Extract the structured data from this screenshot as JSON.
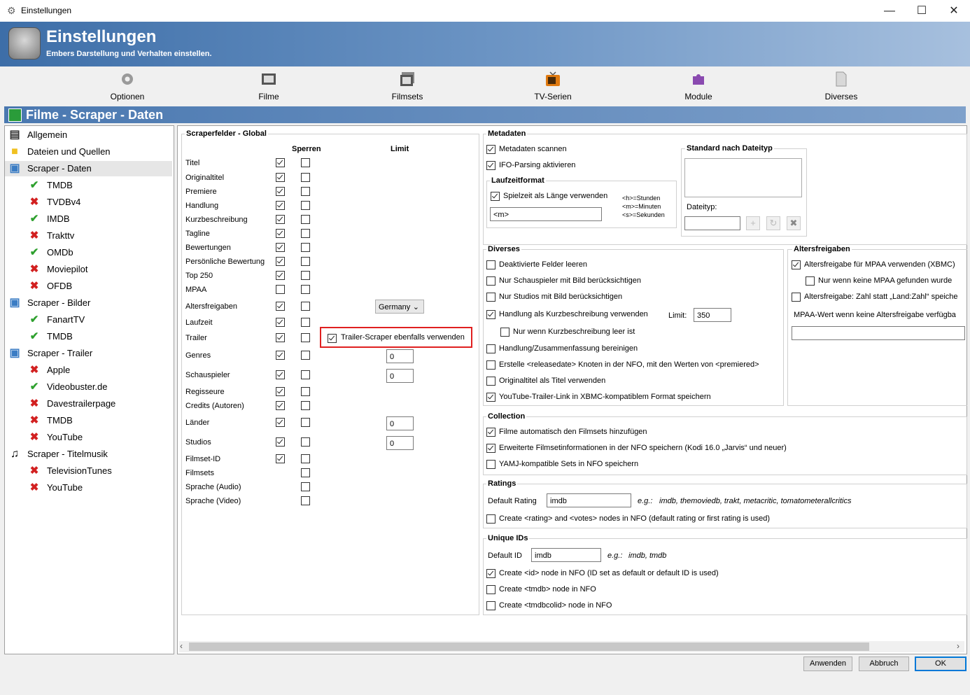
{
  "window": {
    "title": "Einstellungen",
    "minimize": "—",
    "maximize": "☐",
    "close": "✕"
  },
  "banner": {
    "title": "Einstellungen",
    "subtitle": "Embers Darstellung und Verhalten einstellen."
  },
  "toolbar": [
    {
      "label": "Optionen",
      "icon": "gear-icon"
    },
    {
      "label": "Filme",
      "icon": "film-icon"
    },
    {
      "label": "Filmsets",
      "icon": "filmsets-icon"
    },
    {
      "label": "TV-Serien",
      "icon": "tv-icon"
    },
    {
      "label": "Module",
      "icon": "puzzle-icon"
    },
    {
      "label": "Diverses",
      "icon": "document-icon"
    }
  ],
  "section_title": "Filme - Scraper - Daten",
  "sidebar": [
    {
      "label": "Allgemein",
      "icon": "film-icon",
      "level": 0
    },
    {
      "label": "Dateien und Quellen",
      "icon": "folder-icon",
      "level": 0
    },
    {
      "label": "Scraper - Daten",
      "icon": "scraper-icon",
      "level": 0,
      "selected": true
    },
    {
      "label": "TMDB",
      "icon": "check-icon",
      "level": 1,
      "status": "check"
    },
    {
      "label": "TVDBv4",
      "icon": "cross-icon",
      "level": 1,
      "status": "cross"
    },
    {
      "label": "IMDB",
      "icon": "check-icon",
      "level": 1,
      "status": "check"
    },
    {
      "label": "Trakttv",
      "icon": "cross-icon",
      "level": 1,
      "status": "cross"
    },
    {
      "label": "OMDb",
      "icon": "check-icon",
      "level": 1,
      "status": "check"
    },
    {
      "label": "Moviepilot",
      "icon": "cross-icon",
      "level": 1,
      "status": "cross"
    },
    {
      "label": "OFDB",
      "icon": "cross-icon",
      "level": 1,
      "status": "cross"
    },
    {
      "label": "Scraper - Bilder",
      "icon": "image-icon",
      "level": 0
    },
    {
      "label": "FanartTV",
      "icon": "check-icon",
      "level": 1,
      "status": "check"
    },
    {
      "label": "TMDB",
      "icon": "check-icon",
      "level": 1,
      "status": "check"
    },
    {
      "label": "Scraper - Trailer",
      "icon": "image-icon",
      "level": 0
    },
    {
      "label": "Apple",
      "icon": "cross-icon",
      "level": 1,
      "status": "cross"
    },
    {
      "label": "Videobuster.de",
      "icon": "check-icon",
      "level": 1,
      "status": "check"
    },
    {
      "label": "Davestrailerpage",
      "icon": "cross-icon",
      "level": 1,
      "status": "cross"
    },
    {
      "label": "TMDB",
      "icon": "cross-icon",
      "level": 1,
      "status": "cross"
    },
    {
      "label": "YouTube",
      "icon": "cross-icon",
      "level": 1,
      "status": "cross"
    },
    {
      "label": "Scraper - Titelmusik",
      "icon": "music-icon",
      "level": 0
    },
    {
      "label": "TelevisionTunes",
      "icon": "cross-icon",
      "level": 1,
      "status": "cross"
    },
    {
      "label": "YouTube",
      "icon": "cross-icon",
      "level": 1,
      "status": "cross"
    }
  ],
  "scraperfelder": {
    "title": "Scraperfelder - Global",
    "col_sperren": "Sperren",
    "col_limit": "Limit",
    "rows": [
      {
        "label": "Titel",
        "enabled": true,
        "locked": false
      },
      {
        "label": "Originaltitel",
        "enabled": true,
        "locked": false
      },
      {
        "label": "Premiere",
        "enabled": true,
        "locked": false
      },
      {
        "label": "Handlung",
        "enabled": true,
        "locked": false
      },
      {
        "label": "Kurzbeschreibung",
        "enabled": true,
        "locked": false
      },
      {
        "label": "Tagline",
        "enabled": true,
        "locked": false
      },
      {
        "label": "Bewertungen",
        "enabled": true,
        "locked": false
      },
      {
        "label": "Persönliche Bewertung",
        "enabled": true,
        "locked": false
      },
      {
        "label": "Top 250",
        "enabled": true,
        "locked": false
      },
      {
        "label": "MPAA",
        "enabled": false,
        "locked": false
      },
      {
        "label": "Altersfreigaben",
        "enabled": true,
        "locked": false
      },
      {
        "label": "Laufzeit",
        "enabled": true,
        "locked": false
      },
      {
        "label": "Trailer",
        "enabled": true,
        "locked": false
      },
      {
        "label": "Genres",
        "enabled": true,
        "locked": false
      },
      {
        "label": "Schauspieler",
        "enabled": true,
        "locked": false
      },
      {
        "label": "Regisseure",
        "enabled": true,
        "locked": false
      },
      {
        "label": "Credits (Autoren)",
        "enabled": true,
        "locked": false
      },
      {
        "label": "Länder",
        "enabled": true,
        "locked": false
      },
      {
        "label": "Studios",
        "enabled": true,
        "locked": false
      },
      {
        "label": "Filmset-ID",
        "enabled": true,
        "locked": false
      },
      {
        "label": "Filmsets",
        "enabled": null,
        "locked": false
      },
      {
        "label": "Sprache (Audio)",
        "enabled": null,
        "locked": false
      },
      {
        "label": "Sprache (Video)",
        "enabled": null,
        "locked": false
      }
    ],
    "altersfreigaben_select": "Germany",
    "trailer_scraper": {
      "label": "Trailer-Scraper ebenfalls verwenden",
      "checked": true
    },
    "limit_genres": "0",
    "limit_schauspieler": "0",
    "limit_laender": "0",
    "limit_studios": "0"
  },
  "metadaten": {
    "title": "Metadaten",
    "scan": {
      "label": "Metadaten scannen",
      "checked": true
    },
    "ifo": {
      "label": "IFO-Parsing aktivieren",
      "checked": true
    },
    "laufzeit_title": "Laufzeitformat",
    "spielzeit": {
      "label": "Spielzeit als Länge verwenden",
      "checked": true
    },
    "format_value": "<m>",
    "legend_h": "<h>=Stunden",
    "legend_m": "<m>=Minuten",
    "legend_s": "<s>=Sekunden",
    "std_title": "Standard nach Dateityp",
    "dateityp_label": "Dateityp:",
    "dateityp_value": ""
  },
  "diverses": {
    "title": "Diverses",
    "items": [
      {
        "label": "Deaktivierte Felder leeren",
        "checked": false
      },
      {
        "label": "Nur Schauspieler mit Bild berücksichtigen",
        "checked": false
      },
      {
        "label": "Nur Studios mit Bild berücksichtigen",
        "checked": false
      },
      {
        "label": "Handlung als Kurzbeschreibung verwenden",
        "checked": true
      },
      {
        "label": "Nur wenn Kurzbeschreibung leer ist",
        "checked": false
      },
      {
        "label": "Handlung/Zusammenfassung bereinigen",
        "checked": false
      },
      {
        "label": "Erstelle <releasedate> Knoten in der NFO, mit den Werten von <premiered>",
        "checked": false
      },
      {
        "label": "Originaltitel als Titel verwenden",
        "checked": false
      },
      {
        "label": "YouTube-Trailer-Link in XBMC-kompatiblem Format speichern",
        "checked": true
      }
    ],
    "limit_label": "Limit:",
    "limit_value": "350"
  },
  "altersfreigaben": {
    "title": "Altersfreigaben",
    "items": [
      {
        "label": "Altersfreigabe für MPAA verwenden (XBMC)",
        "checked": true
      },
      {
        "label": "Nur wenn keine MPAA gefunden wurde",
        "checked": false
      },
      {
        "label": "Altersfreigabe: Zahl statt „Land:Zahl“ speiche",
        "checked": false
      }
    ],
    "mpaa_label": "MPAA-Wert wenn keine Altersfreigabe verfügba",
    "mpaa_value": ""
  },
  "collection": {
    "title": "Collection",
    "items": [
      {
        "label": "Filme automatisch den Filmsets hinzufügen",
        "checked": true
      },
      {
        "label": "Erweiterte Filmsetinformationen in der NFO speichern (Kodi 16.0 „Jarvis“ und neuer)",
        "checked": true
      },
      {
        "label": "YAMJ-kompatible Sets in NFO speichern",
        "checked": false
      }
    ]
  },
  "ratings": {
    "title": "Ratings",
    "default_label": "Default Rating",
    "default_value": "imdb",
    "eg": "e.g.:",
    "eg_text": "imdb, themoviedb, trakt, metacritic, tomatometerallcritics",
    "create": {
      "label": "Create <rating> and <votes> nodes in NFO (default rating or first rating is used)",
      "checked": false
    }
  },
  "unique_ids": {
    "title": "Unique IDs",
    "default_label": "Default ID",
    "default_value": "imdb",
    "eg": "e.g.:",
    "eg_text": "imdb, tmdb",
    "items": [
      {
        "label": "Create <id> node in NFO (ID set as default or default ID is used)",
        "checked": true
      },
      {
        "label": "Create <tmdb> node in NFO",
        "checked": false
      },
      {
        "label": "Create <tmdbcolid> node in NFO",
        "checked": false
      }
    ]
  },
  "footer": {
    "apply": "Anwenden",
    "cancel": "Abbruch",
    "ok": "OK"
  },
  "colors": {
    "banner": "#3d6ea8",
    "section": "#4a78b0",
    "highlight": "#e02020",
    "check": "#2ea02e",
    "cross": "#d22020"
  }
}
